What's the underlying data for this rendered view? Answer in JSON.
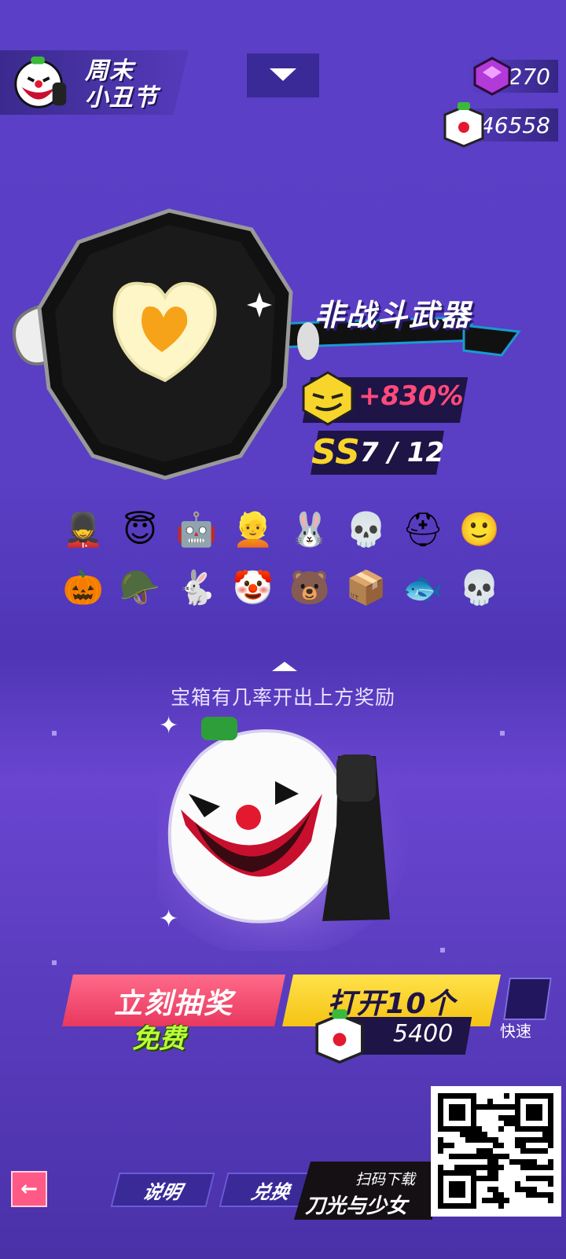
{
  "event": {
    "title_line1": "周末",
    "title_line2": "小丑节"
  },
  "currency": {
    "gems": {
      "icon": "purple-cube-gem-icon",
      "value": "270"
    },
    "chest_tokens": {
      "icon": "clown-box-icon",
      "value": "46558"
    }
  },
  "weapon": {
    "name": "非战斗武器",
    "bonus": "+830%",
    "grade": "SS",
    "collection": "7 / 12"
  },
  "rewards": [
    {
      "icon": "nutcracker-icon",
      "emoji": "💂"
    },
    {
      "icon": "angel-hair-icon",
      "emoji": "😇"
    },
    {
      "icon": "robot-helmet-icon",
      "emoji": "🤖"
    },
    {
      "icon": "blonde-hair-icon",
      "emoji": "👱"
    },
    {
      "icon": "black-bunny-icon",
      "emoji": "🐰"
    },
    {
      "icon": "horned-skull-icon",
      "emoji": "💀"
    },
    {
      "icon": "black-helmet-icon",
      "emoji": "⛑"
    },
    {
      "icon": "lego-head-icon",
      "emoji": "🙂"
    },
    {
      "icon": "pumpkin-icon",
      "emoji": "🎃"
    },
    {
      "icon": "knight-helmet-icon",
      "emoji": "🪖"
    },
    {
      "icon": "white-bunny-icon",
      "emoji": "🐇"
    },
    {
      "icon": "clown-face-icon",
      "emoji": "🤡"
    },
    {
      "icon": "bear-head-icon",
      "emoji": "🐻"
    },
    {
      "icon": "box-head-icon",
      "emoji": "📦"
    },
    {
      "icon": "fish-head-icon",
      "emoji": "🐟"
    },
    {
      "icon": "reaper-icon",
      "emoji": "💀"
    }
  ],
  "hint": "宝箱有几率开出上方奖励",
  "actions": {
    "draw_label": "立刻抽奖",
    "draw_sub": "免费",
    "open10_label": "打开10个",
    "open10_cost": "5400",
    "quick_label": "快速"
  },
  "footer": {
    "back_icon": "←",
    "tabs": [
      "说明",
      "兑换"
    ],
    "promo_line1": "扫码下载",
    "promo_line2": "刀光与少女"
  },
  "colors": {
    "accent_pink": "#e8385e",
    "accent_yellow": "#f5c314",
    "bonus_red": "#ff4a7a",
    "grade_yellow": "#f8d52a"
  }
}
